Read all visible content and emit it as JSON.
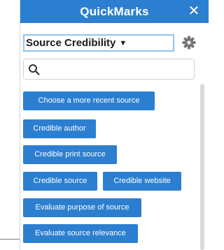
{
  "header": {
    "title": "QuickMarks",
    "close_glyph": "✕"
  },
  "category_select": {
    "value": "Source Credibility",
    "caret": "▼"
  },
  "settings": {
    "icon": "gear-icon"
  },
  "search": {
    "icon": "search-icon",
    "value": ""
  },
  "buttons": {
    "choose_recent": "Choose a more recent source",
    "credible_author": "Credible author",
    "credible_print": "Credible print source",
    "credible_source": "Credible source",
    "credible_website": "Credible website",
    "evaluate_purpose": "Evaluate purpose of source",
    "evaluate_relevance": "Evaluate source relevance"
  },
  "colors": {
    "accent": "#2c7fd0",
    "select_border": "#8fc4ee",
    "gear": "#777777"
  }
}
